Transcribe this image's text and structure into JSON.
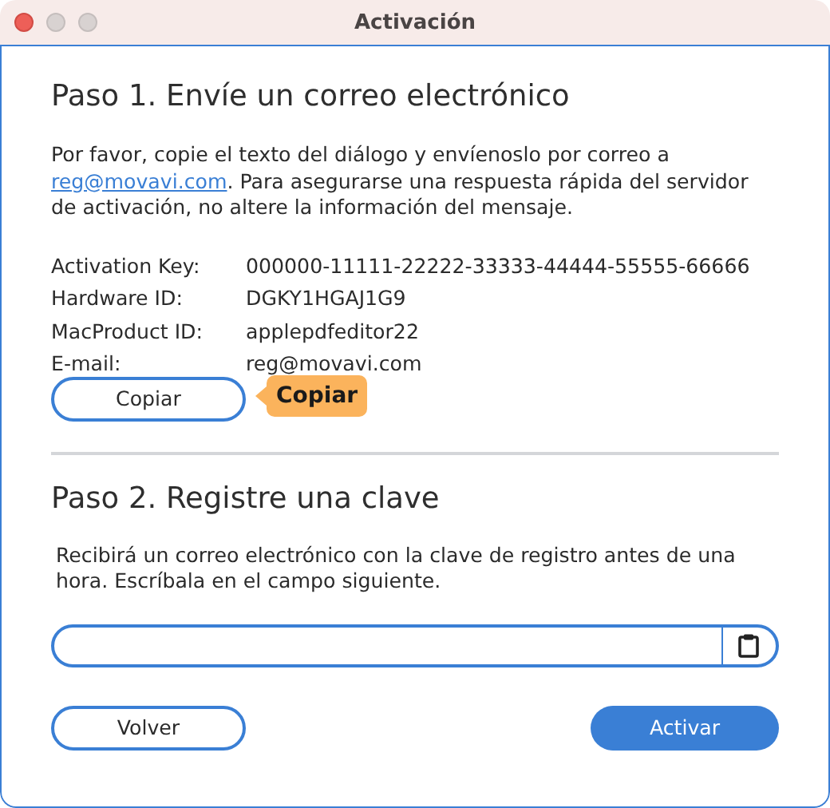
{
  "window": {
    "title": "Activación"
  },
  "step1": {
    "heading": "Paso 1. Envíe un correo electrónico",
    "text_before": "Por favor, copie el texto del diálogo y envíenoslo por correo a ",
    "link": "reg@movavi.com",
    "text_after": ". Para asegurarse una respuesta rápida del servidor de activación, no altere la información del mensaje.",
    "fields": [
      {
        "label": "Activation Key:",
        "value": "000000-11111-22222-33333-44444-55555-66666"
      },
      {
        "label": "Hardware ID:",
        "value": "DGKY1HGAJ1G9"
      },
      {
        "label": "MacProduct ID:",
        "value": "applepdfeditor22"
      },
      {
        "label": "E-mail:",
        "value": "reg@movavi.com"
      }
    ],
    "copy_button": "Copiar",
    "tooltip": "Copiar"
  },
  "step2": {
    "heading": "Paso 2. Registre una clave",
    "text": "Recibirá un correo electrónico con la clave de registro antes de una hora. Escríbala en el campo siguiente."
  },
  "buttons": {
    "back": "Volver",
    "activate": "Activar"
  }
}
